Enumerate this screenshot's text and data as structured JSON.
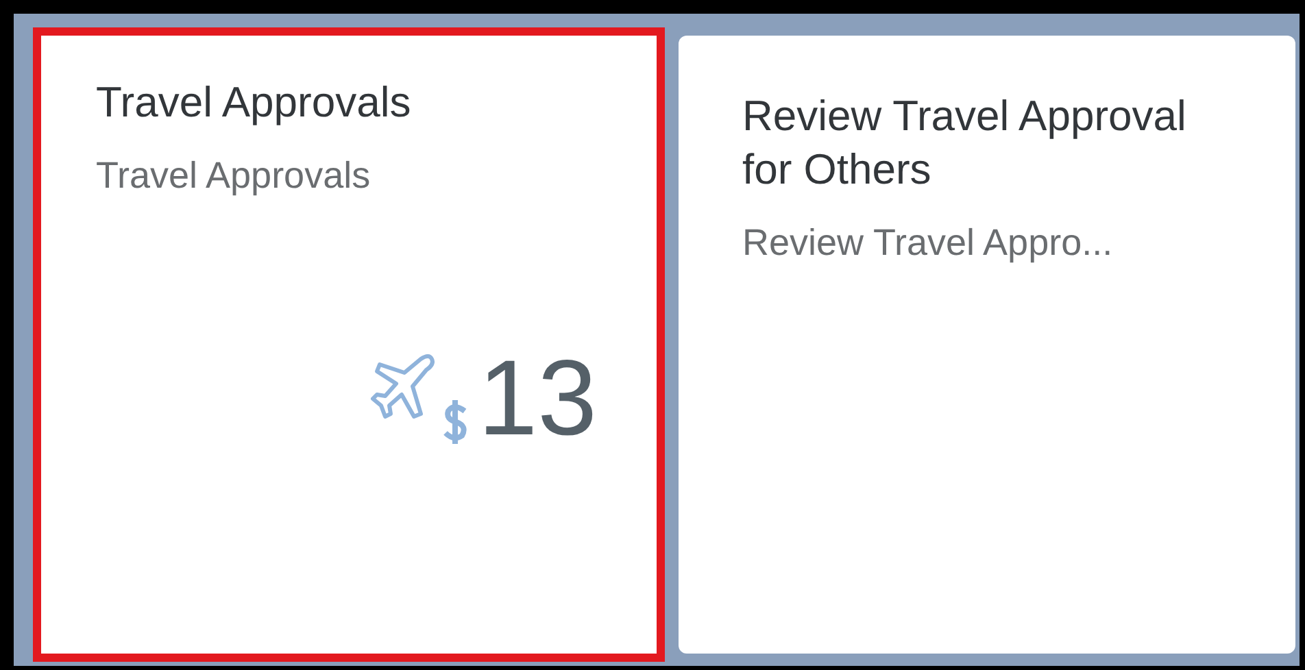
{
  "tiles": [
    {
      "title": "Travel Approvals",
      "subtitle": "Travel Approvals",
      "highlighted": true,
      "kind": "numeric",
      "number": "13"
    },
    {
      "title": "Review Travel Approval for Others",
      "subtitle": "Review Travel Appro...",
      "highlighted": false,
      "kind": "launch"
    }
  ]
}
